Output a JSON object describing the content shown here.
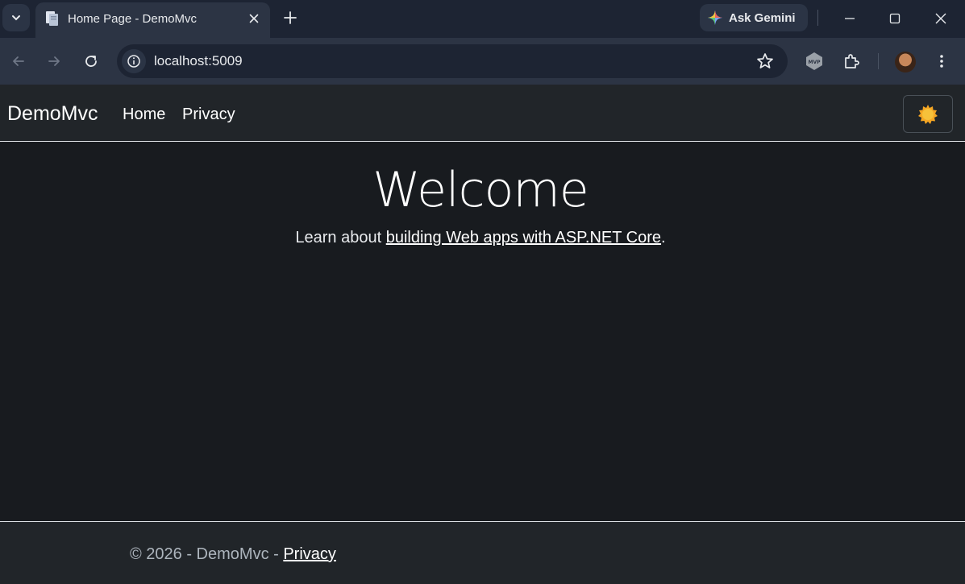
{
  "browser": {
    "tab": {
      "title": "Home Page - DemoMvc"
    },
    "gemini_button": {
      "label": "Ask Gemini"
    },
    "address_bar": {
      "url": "localhost:5009"
    }
  },
  "site": {
    "brand": "DemoMvc",
    "nav": [
      {
        "label": "Home"
      },
      {
        "label": "Privacy"
      }
    ],
    "theme_toggle_icon": "sun-icon"
  },
  "main": {
    "heading": "Welcome",
    "lead_prefix": "Learn about ",
    "lead_link": "building Web apps with ASP.NET Core",
    "lead_suffix": "."
  },
  "footer": {
    "text": "© 2026 - DemoMvc - ",
    "link": "Privacy"
  },
  "colors": {
    "page_bg": "#181b1f",
    "navbar_bg": "#212529",
    "chrome_tabstrip": "#1d2433",
    "chrome_toolbar": "#2c3444",
    "sun": "#f5a623"
  }
}
